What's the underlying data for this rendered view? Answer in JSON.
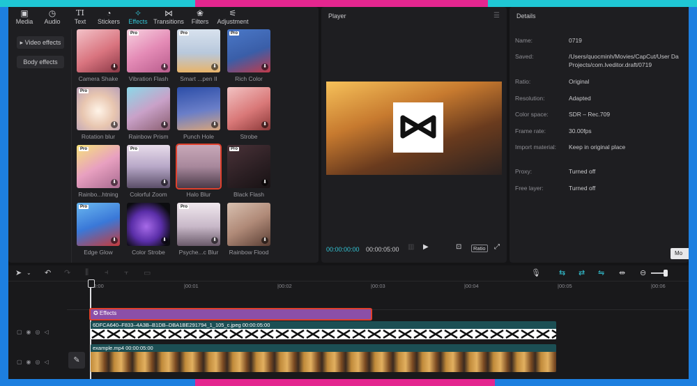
{
  "toolbar": {
    "tabs": [
      {
        "label": "Media",
        "icon": "media-icon"
      },
      {
        "label": "Audio",
        "icon": "audio-icon"
      },
      {
        "label": "Text",
        "icon": "text-icon"
      },
      {
        "label": "Stickers",
        "icon": "stickers-icon"
      },
      {
        "label": "Effects",
        "icon": "effects-icon",
        "active": true
      },
      {
        "label": "Transitions",
        "icon": "transitions-icon"
      },
      {
        "label": "Filters",
        "icon": "filters-icon"
      },
      {
        "label": "Adjustment",
        "icon": "adjustment-icon"
      }
    ]
  },
  "categories": {
    "video_effects": "▸ Video effects",
    "body_effects": "Body effects"
  },
  "effects": [
    {
      "label": "Camera Shake",
      "pro": false,
      "download": true
    },
    {
      "label": "Vibration Flash",
      "pro": true,
      "download": true
    },
    {
      "label": "Smart ...pen II",
      "pro": true,
      "download": true
    },
    {
      "label": "Rich Color",
      "pro": true,
      "download": true
    },
    {
      "label": "Rotation blur",
      "pro": true,
      "download": true
    },
    {
      "label": "Rainbow Prism",
      "pro": false,
      "download": true
    },
    {
      "label": "Punch Hole",
      "pro": false,
      "download": true
    },
    {
      "label": "Strobe",
      "pro": false,
      "download": true
    },
    {
      "label": "Rainbo...htning",
      "pro": true,
      "download": true
    },
    {
      "label": "Colorful Zoom",
      "pro": true,
      "download": true
    },
    {
      "label": "Halo Blur",
      "pro": false,
      "download": false,
      "selected": true
    },
    {
      "label": "Black Flash",
      "pro": true,
      "download": true
    },
    {
      "label": "Edge Glow",
      "pro": true,
      "download": true
    },
    {
      "label": "Color Strobe",
      "pro": false,
      "download": true
    },
    {
      "label": "Psyche...c Blur",
      "pro": true,
      "download": true
    },
    {
      "label": "Rainbow Flood",
      "pro": false,
      "download": true
    }
  ],
  "player": {
    "title": "Player",
    "current_time": "00:00:00:00",
    "total_time": "00:00:05:00",
    "ratio_label": "Ratio"
  },
  "details": {
    "title": "Details",
    "rows": [
      {
        "label": "Name:",
        "value": "0719"
      },
      {
        "label": "Saved:",
        "value": "/Users/quocminh/Movies/CapCut/User Da",
        "value2": "Projects/com.lveditor.draft/0719"
      },
      {
        "label": "Ratio:",
        "value": "Original"
      },
      {
        "label": "Resolution:",
        "value": "Adapted"
      },
      {
        "label": "Color space:",
        "value": "SDR – Rec.709"
      },
      {
        "label": "Frame rate:",
        "value": "30.00fps"
      },
      {
        "label": "Import material:",
        "value": "Keep in original place"
      },
      {
        "label": "Proxy:",
        "value": "Turned off"
      },
      {
        "label": "Free layer:",
        "value": "Turned off"
      }
    ],
    "modify_label": "Mo"
  },
  "timeline": {
    "ticks": [
      "00:00",
      "|00:01",
      "|00:02",
      "|00:03",
      "|00:04",
      "|00:05",
      "|00:06"
    ],
    "effect_clip_label": "✪ Effects",
    "image_clip_label": "6DFCA640–F833–4A3B–B1DB–DBA1BE291794_1_105_c.jpeg   00:00:05:00",
    "video_clip_label": "example.mp4   00:00:05:00"
  },
  "colors": {
    "accent": "#33c5d6",
    "selection": "#e0402c",
    "effect_clip": "#8b4fa8",
    "media_clip": "#1c4f54"
  }
}
